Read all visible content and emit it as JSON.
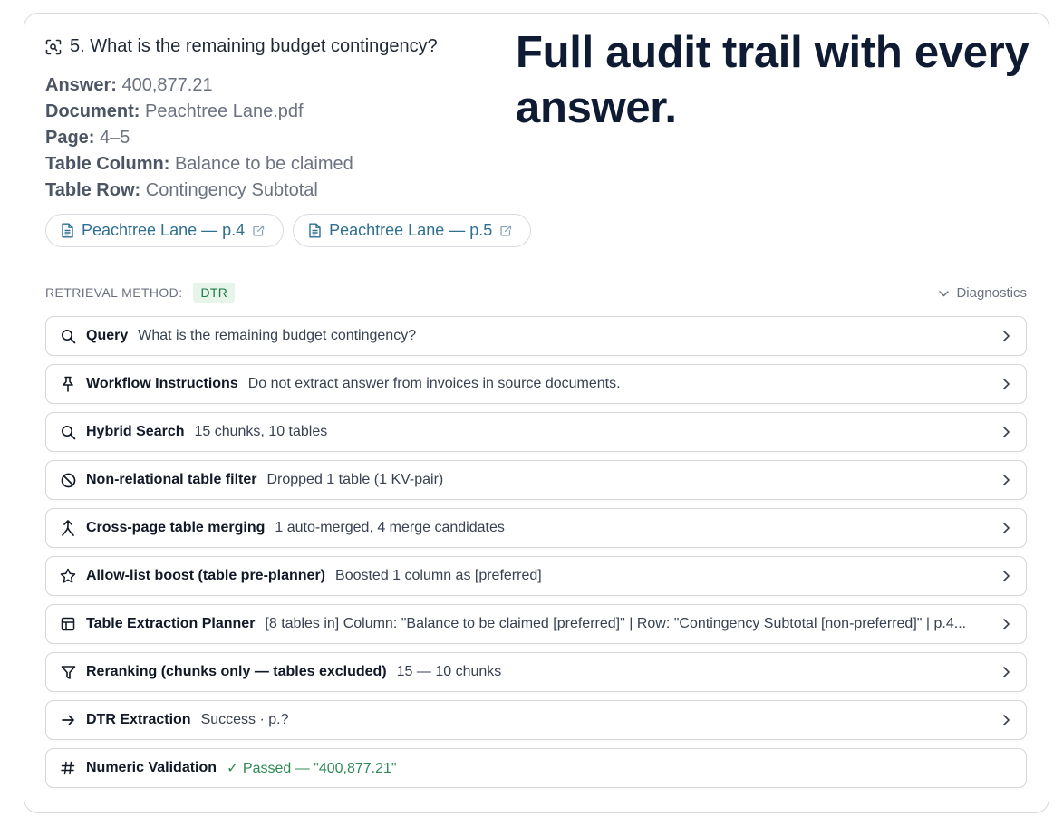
{
  "question": {
    "text": "5. What is the remaining budget contingency?",
    "icon": "scan-icon"
  },
  "details": [
    {
      "label": "Answer:",
      "value": "400,877.21"
    },
    {
      "label": "Document:",
      "value": "Peachtree Lane.pdf"
    },
    {
      "label": "Page:",
      "value": "4–5"
    },
    {
      "label": "Table Column:",
      "value": "Balance to be claimed"
    },
    {
      "label": "Table Row:",
      "value": "Contingency Subtotal"
    }
  ],
  "headline": "Full audit trail with every answer.",
  "sources": [
    {
      "label": "Peachtree Lane — p.4",
      "icon": "file-icon"
    },
    {
      "label": "Peachtree Lane — p.5",
      "icon": "file-icon"
    }
  ],
  "retrieval": {
    "label": "RETRIEVAL METHOD:",
    "method": "DTR",
    "diagnostics_label": "Diagnostics"
  },
  "steps": [
    {
      "icon": "search-icon",
      "title": "Query",
      "desc": "What is the remaining budget contingency?"
    },
    {
      "icon": "pin-icon",
      "title": "Workflow Instructions",
      "desc": "Do not extract answer from invoices in source documents."
    },
    {
      "icon": "search-icon",
      "title": "Hybrid Search",
      "desc": "15 chunks, 10 tables"
    },
    {
      "icon": "ban-icon",
      "title": "Non-relational table filter",
      "desc": "Dropped 1 table (1 KV-pair)"
    },
    {
      "icon": "merge-icon",
      "title": "Cross-page table merging",
      "desc": "1 auto-merged, 4 merge candidates"
    },
    {
      "icon": "star-icon",
      "title": "Allow-list boost (table pre-planner)",
      "desc": "Boosted 1 column as [preferred]"
    },
    {
      "icon": "table-icon",
      "title": "Table Extraction Planner",
      "desc": "[8 tables in] Column: \"Balance to be claimed [preferred]\" | Row: \"Contingency Subtotal [non-preferred]\" | p.4..."
    },
    {
      "icon": "filter-icon",
      "title": "Reranking (chunks only — tables excluded)",
      "desc": "15 — 10 chunks"
    },
    {
      "icon": "arrow-right-icon",
      "title": "DTR Extraction",
      "desc": "Success · p.?"
    },
    {
      "icon": "hash-icon",
      "title": "Numeric Validation",
      "desc": "✓ Passed — \"400,877.21\""
    }
  ],
  "colors": {
    "headline": "#0f1b33",
    "link": "#2f6f8f",
    "badge_bg": "#e6f4ea",
    "badge_text": "#1e7a46",
    "passed": "#2f8a57"
  }
}
